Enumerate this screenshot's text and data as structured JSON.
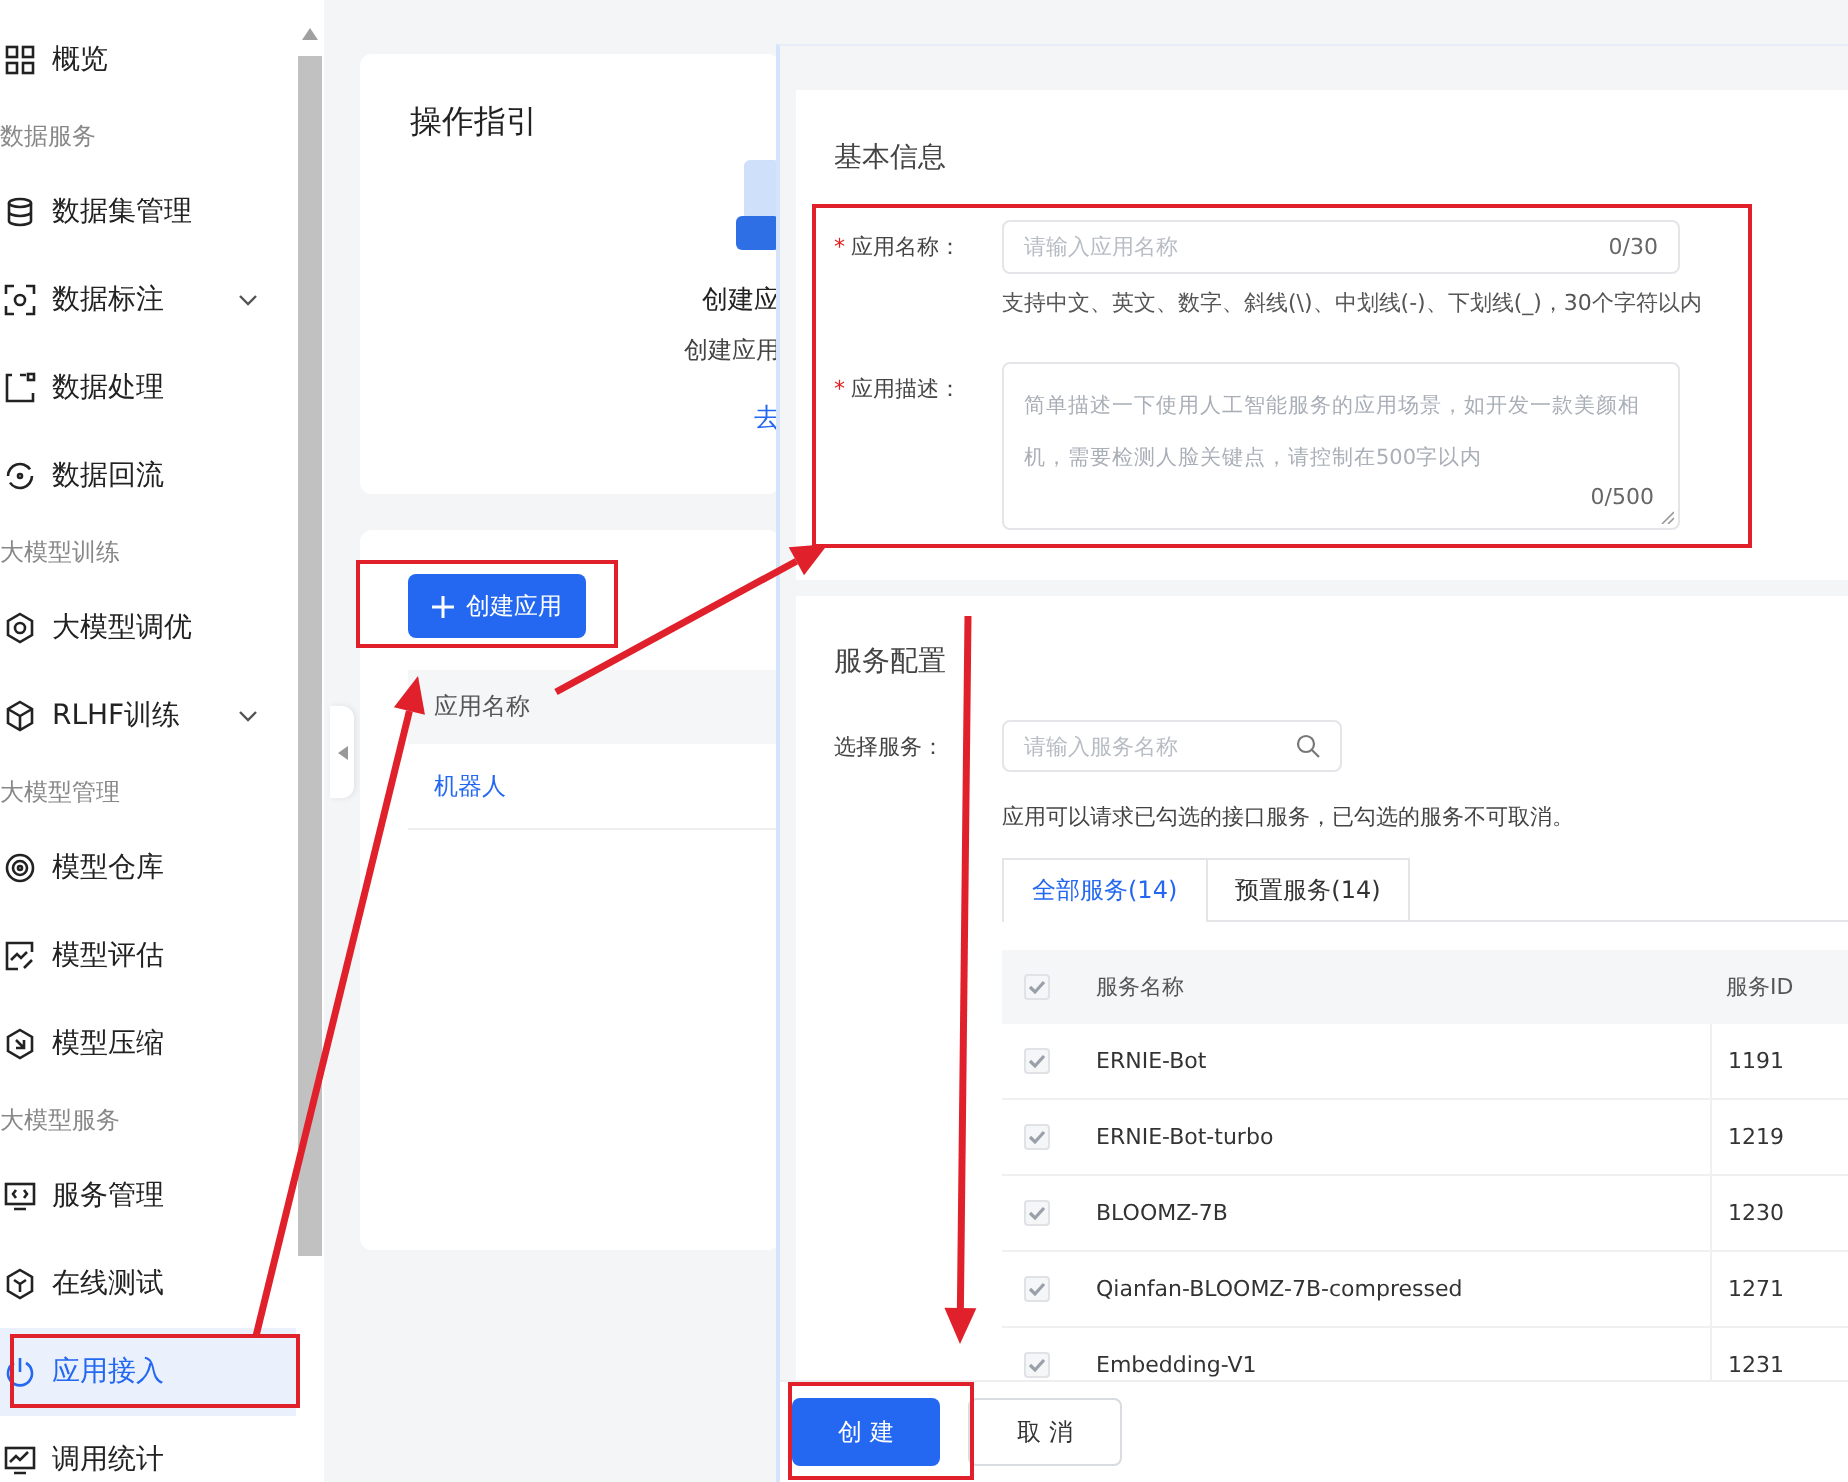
{
  "sidebar": {
    "sections": [
      {
        "items": [
          {
            "label": "概览",
            "kind": "link",
            "selected": false
          }
        ]
      },
      {
        "label": "数据服务",
        "items": [
          {
            "label": "数据集管理",
            "kind": "link",
            "selected": false
          },
          {
            "label": "数据标注",
            "kind": "submenu",
            "selected": false
          },
          {
            "label": "数据处理",
            "kind": "link",
            "selected": false
          },
          {
            "label": "数据回流",
            "kind": "link",
            "selected": false
          }
        ]
      },
      {
        "label": "大模型训练",
        "items": [
          {
            "label": "大模型调优",
            "kind": "link",
            "selected": false
          },
          {
            "label": "RLHF训练",
            "kind": "submenu",
            "selected": false
          }
        ]
      },
      {
        "label": "大模型管理",
        "items": [
          {
            "label": "模型仓库",
            "kind": "link",
            "selected": false
          },
          {
            "label": "模型评估",
            "kind": "link",
            "selected": false
          },
          {
            "label": "模型压缩",
            "kind": "link",
            "selected": false
          }
        ]
      },
      {
        "label": "大模型服务",
        "items": [
          {
            "label": "服务管理",
            "kind": "link",
            "selected": false
          },
          {
            "label": "在线测试",
            "kind": "link",
            "selected": false
          },
          {
            "label": "应用接入",
            "kind": "link",
            "selected": true
          },
          {
            "label": "调用统计",
            "kind": "link",
            "selected": false
          }
        ]
      }
    ]
  },
  "guide": {
    "title": "操作指引",
    "heading": "创建应",
    "text": "创建应用",
    "link": "去"
  },
  "apps": {
    "create_button": "创建应用",
    "columns": [
      "应用名称"
    ],
    "rows": [
      {
        "name": "机器人"
      }
    ]
  },
  "drawer": {
    "basic": {
      "title": "基本信息",
      "name_field": {
        "label": "应用名称：",
        "required_mark": "*",
        "placeholder": "请输入应用名称",
        "counter": "0/30",
        "hint": "支持中文、英文、数字、斜线(\\)、中划线(-)、下划线(_)，30个字符以内"
      },
      "desc_field": {
        "label": "应用描述：",
        "required_mark": "*",
        "placeholder": "简单描述一下使用人工智能服务的应用场景，如开发一款美颜相机，需要检测人脸关键点，请控制在500字以内",
        "counter": "0/500"
      }
    },
    "services": {
      "title": "服务配置",
      "search_label": "选择服务：",
      "search_placeholder": "请输入服务名称",
      "note": "应用可以请求已勾选的接口服务，已勾选的服务不可取消。",
      "tabs": [
        {
          "label": "全部服务(14)",
          "selected": true
        },
        {
          "label": "预置服务(14)",
          "selected": false
        }
      ],
      "table": {
        "all_checked": true,
        "columns": [
          "服务名称",
          "服务ID"
        ],
        "rows": [
          {
            "name": "ERNIE-Bot",
            "id": "1191",
            "checked": true
          },
          {
            "name": "ERNIE-Bot-turbo",
            "id": "1219",
            "checked": true
          },
          {
            "name": "BLOOMZ-7B",
            "id": "1230",
            "checked": true
          },
          {
            "name": "Qianfan-BLOOMZ-7B-compressed",
            "id": "1271",
            "checked": true
          },
          {
            "name": "Embedding-V1",
            "id": "1231",
            "checked": true
          }
        ]
      }
    },
    "buttons": [
      {
        "label": "创 建",
        "kind": "primary"
      },
      {
        "label": "取 消",
        "kind": "secondary"
      }
    ]
  }
}
